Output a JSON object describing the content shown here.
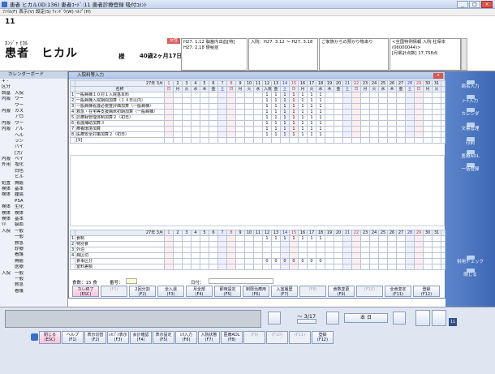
{
  "window": {
    "title": "患者 ヒカル(ID:136) 患者ｺｰﾄﾞ:11 患者診療登録 吸付ｺﾒﾝﾄ",
    "menu": "ﾌｧｲﾙ(F)  表示(V)  設定(S)  ｳｨﾝﾄﾞｳ(W)  ﾍﾙﾌﾟ(H)"
  },
  "patient": {
    "number": "11",
    "kana": "ｶﾝｼﾞｬ ﾋｶﾙ",
    "name": "患者　ヒカル",
    "honorific": "様",
    "age": "40歳2ヶ月17日",
    "badge": "女性",
    "box1": "H27. 1.12 脳塞内出血[特]\nH27. 2.18 便秘症",
    "box2": "入院：H27. 3.12 ～ H27. 3.18",
    "box3": "ご家族からの預かり物あり",
    "box4": "<全国特例情報 入院 社保本\n(06000044)>\n[月累計点数] 17,758点"
  },
  "leftpanel": {
    "title": "カレンダーボード",
    "rows": [
      {
        "c": "+ -",
        "t": ""
      },
      {
        "c": "区分",
        "t": ""
      },
      {
        "c": "調基",
        "t": "入院"
      },
      {
        "c": "内服",
        "t": "ワー"
      },
      {
        "c": "",
        "t": "ワー"
      },
      {
        "c": "内服",
        "t": "ガス"
      },
      {
        "c": "",
        "t": "アロ"
      },
      {
        "c": "内服",
        "t": "ワー"
      },
      {
        "c": "内服",
        "t": "アル"
      },
      {
        "c": "",
        "t": "ヘル"
      },
      {
        "c": "",
        "t": "ラン"
      },
      {
        "c": "",
        "t": "バイ"
      },
      {
        "c": "",
        "t": "[力/"
      },
      {
        "c": "内服",
        "t": "ベイ"
      },
      {
        "c": "外用",
        "t": "塩化"
      },
      {
        "c": "",
        "t": "白色"
      },
      {
        "c": "",
        "t": "ヒル"
      },
      {
        "c": "処置",
        "t": "褥瘡"
      },
      {
        "c": "検体",
        "t": "基本"
      },
      {
        "c": "検体",
        "t": "腫瘍"
      },
      {
        "c": "",
        "t": "PSA"
      },
      {
        "c": "検体",
        "t": "生化"
      },
      {
        "c": "検体",
        "t": "検体"
      },
      {
        "c": "検体",
        "t": "基本"
      },
      {
        "c": "ﾘﾊ",
        "t": "脳血"
      },
      {
        "c": "入院",
        "t": "一般"
      },
      {
        "c": "",
        "t": "一般"
      },
      {
        "c": "",
        "t": "救急"
      },
      {
        "c": "",
        "t": "診療"
      },
      {
        "c": "",
        "t": "看護"
      },
      {
        "c": "",
        "t": "褥瘡"
      },
      {
        "c": "",
        "t": "医療"
      },
      {
        "c": "入院",
        "t": "一般"
      },
      {
        "c": "",
        "t": "一般"
      },
      {
        "c": "",
        "t": "救急"
      },
      {
        "c": "",
        "t": "看護"
      }
    ]
  },
  "dialog": {
    "title": "入院料等入力",
    "month_label": "27年 3月",
    "name_header": "名称",
    "days": [
      "1",
      "2",
      "3",
      "4",
      "5",
      "6",
      "7",
      "8",
      "9",
      "10",
      "11",
      "12",
      "13",
      "14",
      "15",
      "16",
      "17",
      "18",
      "19",
      "20",
      "21",
      "22",
      "23",
      "24",
      "25",
      "26",
      "27",
      "28",
      "29",
      "30",
      "31"
    ],
    "weekdays": [
      "日",
      "月",
      "火",
      "水",
      "木",
      "金",
      "土",
      "日",
      "月",
      "火",
      "水",
      "木",
      "金",
      "土",
      "日",
      "月",
      "火",
      "水",
      "木",
      "金",
      "土",
      "日",
      "月",
      "火",
      "水",
      "木",
      "金",
      "土",
      "日",
      "月",
      "火"
    ],
    "marker": "入院",
    "top_rows": [
      {
        "no": "1",
        "name": "一般病棟１０対１入院基本料"
      },
      {
        "no": "2",
        "name": "一般病棟入院期間加算（１４日以内）"
      },
      {
        "no": "3",
        "name": "一般病棟看護必要度評価加算（一般病棟）"
      },
      {
        "no": "4",
        "name": "救急・在宅等支援病床初期加算（一般病棟）"
      },
      {
        "no": "5",
        "name": "診療録管理体制加算２（初日）"
      },
      {
        "no": "6",
        "name": "看護補助加算３"
      },
      {
        "no": "7",
        "name": "療養環境加算"
      },
      {
        "no": "8",
        "name": "医療安全対策加算２（初日）"
      }
    ],
    "top_values": "1",
    "bottom_rows": [
      {
        "no": "1",
        "name": "食制"
      },
      {
        "no": "2",
        "name": "特別食"
      },
      {
        "no": "3",
        "name": "外泊"
      },
      {
        "no": "4",
        "name": "病区切"
      },
      {
        "no": "",
        "name": "食事区分"
      },
      {
        "no": "",
        "name": "室料差額"
      }
    ],
    "bottom_values": [
      "1",
      "",
      "",
      "",
      "0",
      ""
    ],
    "meal_label": "食数：15 食",
    "number_label": "番号：",
    "date_label": "日付：",
    "buttons": [
      {
        "label": "カレ終了",
        "key": "(ESC)"
      },
      {
        "label": "",
        "key": "(F1)"
      },
      {
        "label": "2回分割",
        "key": "(F2)"
      },
      {
        "label": "全入退",
        "key": "(F3)"
      },
      {
        "label": "月全部",
        "key": "(F4)"
      },
      {
        "label": "即時設定",
        "key": "(F5)"
      },
      {
        "label": "制限治療用",
        "key": "(F6)"
      },
      {
        "label": "入室履歴",
        "key": "(F7)"
      },
      {
        "label": "",
        "key": "(F8)"
      },
      {
        "label": "食数変更",
        "key": "(F9)"
      },
      {
        "label": "",
        "key": "(F10)"
      },
      {
        "label": "全食変定",
        "key": "(F11)"
      },
      {
        "label": "登録",
        "key": "(F12)"
      }
    ]
  },
  "rightbar": [
    {
      "label": "病名入力"
    },
    {
      "label": "ｼｰﾄ入力"
    },
    {
      "label": "カレンダ"
    },
    {
      "label": "文書管理"
    },
    {
      "label": "印刷"
    },
    {
      "label": "医療ADL"
    },
    {
      "label": "一括登録"
    },
    {
      "label": "併用チェック"
    },
    {
      "label": "閉じる"
    }
  ],
  "nav": {
    "page": "～ 3/17",
    "today": "本 日"
  },
  "bottom_buttons": [
    {
      "label": "閉じる",
      "key": "(ESC)"
    },
    {
      "label": "ヘルプ",
      "key": "(F1)"
    },
    {
      "label": "表示切替",
      "key": "(F2)"
    },
    {
      "label": "ﾚｾﾌﾟﾄ表示",
      "key": "(F3)"
    },
    {
      "label": "会計確認",
      "key": "(F4)"
    },
    {
      "label": "表示設定",
      "key": "(F5)"
    },
    {
      "label": "ﾚｾ入力",
      "key": "(F6)"
    },
    {
      "label": "入院状態",
      "key": "(F7)"
    },
    {
      "label": "医療ADL",
      "key": "(F8)"
    },
    {
      "label": "",
      "key": "(F9)"
    },
    {
      "label": "",
      "key": "(F10)"
    },
    {
      "label": "",
      "key": "(F11)"
    },
    {
      "label": "登録",
      "key": "(F12)"
    }
  ],
  "colors": {
    "accent": "#3e67b3",
    "badge": "#e06060",
    "holiday": "#d33"
  }
}
